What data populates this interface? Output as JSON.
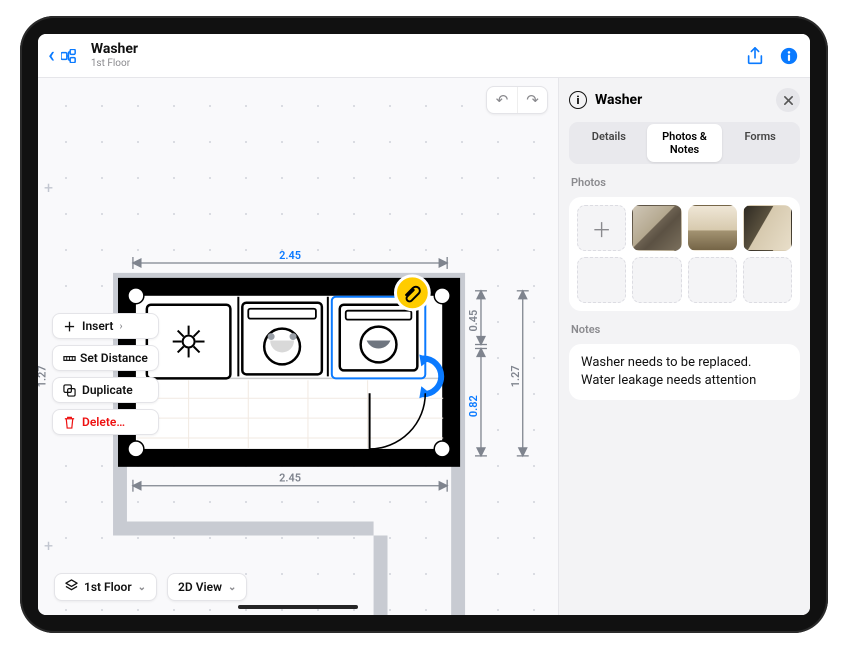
{
  "header": {
    "title": "Washer",
    "subtitle": "1st Floor"
  },
  "canvas": {
    "undo_tooltip": "Undo",
    "redo_tooltip": "Redo",
    "dimensions": {
      "top_width": "2.45",
      "bottom_width": "2.45",
      "right_height": "1.27",
      "left_height": "1.27",
      "sel_height": "0.82",
      "sel_width": "0.45"
    },
    "context_menu": {
      "insert": "Insert",
      "set_distance": "Set Distance",
      "duplicate": "Duplicate",
      "delete": "Delete…"
    },
    "bottom": {
      "floor_label": "1st Floor",
      "view_label": "2D View"
    }
  },
  "inspector": {
    "title": "Washer",
    "tabs": {
      "details": "Details",
      "photos": "Photos & Notes",
      "forms": "Forms"
    },
    "active_tab": "photos",
    "sections": {
      "photos": "Photos",
      "notes": "Notes"
    },
    "notes_text": "Washer needs to be replaced. Water leakage needs attention"
  }
}
